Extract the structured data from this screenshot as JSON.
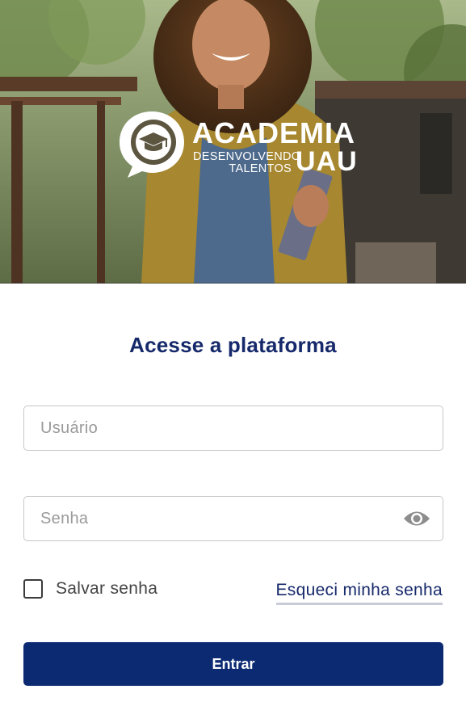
{
  "hero": {
    "image": "student-with-books-photo"
  },
  "logo": {
    "icon": "graduation-cap-speech-bubble-icon",
    "title": "ACADEMIA",
    "subtitle_line1": "DESENVOLVENDO",
    "subtitle_line2": "TALENTOS",
    "brand": "UAU"
  },
  "login": {
    "title": "Acesse a plataforma",
    "username": {
      "placeholder": "Usuário",
      "value": ""
    },
    "password": {
      "placeholder": "Senha",
      "value": "",
      "toggle_icon": "eye-icon"
    },
    "remember_label": "Salvar senha",
    "remember_checked": false,
    "forgot_label": "Esqueci minha senha",
    "submit_label": "Entrar"
  },
  "colors": {
    "primary": "#0b2a72",
    "title": "#16296a",
    "border": "#c7c7c7",
    "placeholder": "#9a9a9a"
  }
}
